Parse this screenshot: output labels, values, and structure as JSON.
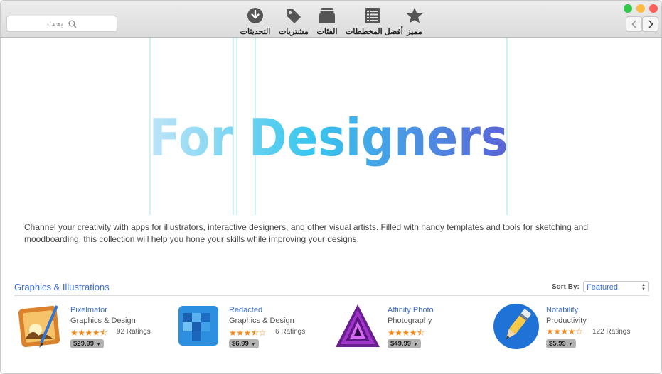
{
  "window": {
    "search_placeholder": "بحث",
    "toolbar": [
      {
        "label": "مميز",
        "icon": "star-icon"
      },
      {
        "label": "أفضل المخططات",
        "icon": "list-icon"
      },
      {
        "label": "الفئات",
        "icon": "stack-icon"
      },
      {
        "label": "مشتريات",
        "icon": "tag-icon"
      },
      {
        "label": "التحديثات",
        "icon": "download-icon"
      }
    ],
    "traffic_colors": {
      "close": "#fc605c",
      "minimize": "#fdbc40",
      "zoom": "#34c84a"
    }
  },
  "hero": {
    "title": "For Designers",
    "gradient": [
      "#bfe4f7",
      "#38c7ee",
      "#5b63d8"
    ]
  },
  "description": "Channel your creativity with apps for illustrators, interactive designers, and other visual artists. Filled with handy templates and tools for sketching and moodboarding, this collection will help you hone your skills while improving your designs.",
  "section": {
    "title": "Graphics & Illustrations",
    "sort_label": "Sort By:",
    "sort_value": "Featured"
  },
  "apps": [
    {
      "name": "Pixelmator",
      "category": "Graphics & Design",
      "stars": "★★★★⯪",
      "ratings": "92 Ratings",
      "price": "$29.99",
      "rating_value": 4.5,
      "icon": "pixelmator-icon"
    },
    {
      "name": "Redacted",
      "category": "Graphics & Design",
      "stars": "★★★⯪☆",
      "ratings": "6 Ratings",
      "price": "$6.99",
      "rating_value": 3.5,
      "icon": "redacted-icon"
    },
    {
      "name": "Affinity Photo",
      "category": "Photography",
      "stars": "★★★★⯪",
      "ratings": "",
      "price": "$49.99",
      "rating_value": 4.5,
      "icon": "affinity-photo-icon"
    },
    {
      "name": "Notability",
      "category": "Productivity",
      "stars": "★★★★☆",
      "ratings": "122 Ratings",
      "price": "$5.99",
      "rating_value": 4,
      "icon": "notability-icon"
    }
  ],
  "colors": {
    "accent": "#3b6ed7",
    "star": "#f2891c"
  }
}
